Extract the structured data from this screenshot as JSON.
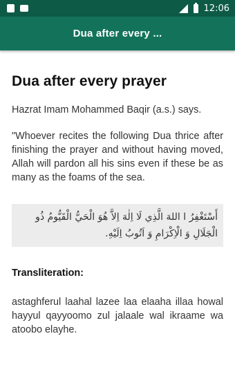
{
  "status_bar": {
    "time": "12:06",
    "icons": [
      "notification-icon",
      "notification-icon",
      "signal-icon",
      "battery-icon"
    ]
  },
  "app_bar": {
    "title": "Dua after every ..."
  },
  "content": {
    "title": "Dua after every prayer",
    "attribution": "Hazrat Imam Mohammed Baqir (a.s.) says.",
    "quote": "\"Whoever recites the following Dua thrice after finishing the prayer and without having moved, Allah will pardon all his sins even if these be as many as the foams of the sea.",
    "arabic": "أَسْتَغْفِرُ ا اللهَ الَّذِي لَا اِلٰهَ اِلاَّ هُوَ الْحَيُّ الْقَيُّومُ ذُو الْجَلَالِ وَ الْاِكْرَامِ وَ اَتُوبُ اِلَيْهِ.",
    "transliteration_label": "Transliteration:",
    "transliteration": "astaghferul laahal lazee laa elaaha illaa howal hayyul qayyoomo zul jalaale wal ikraame wa atoobo elayhe."
  },
  "colors": {
    "status_bar": "#0d5a46",
    "app_bar": "#13735a",
    "arabic_box": "#ececec"
  }
}
